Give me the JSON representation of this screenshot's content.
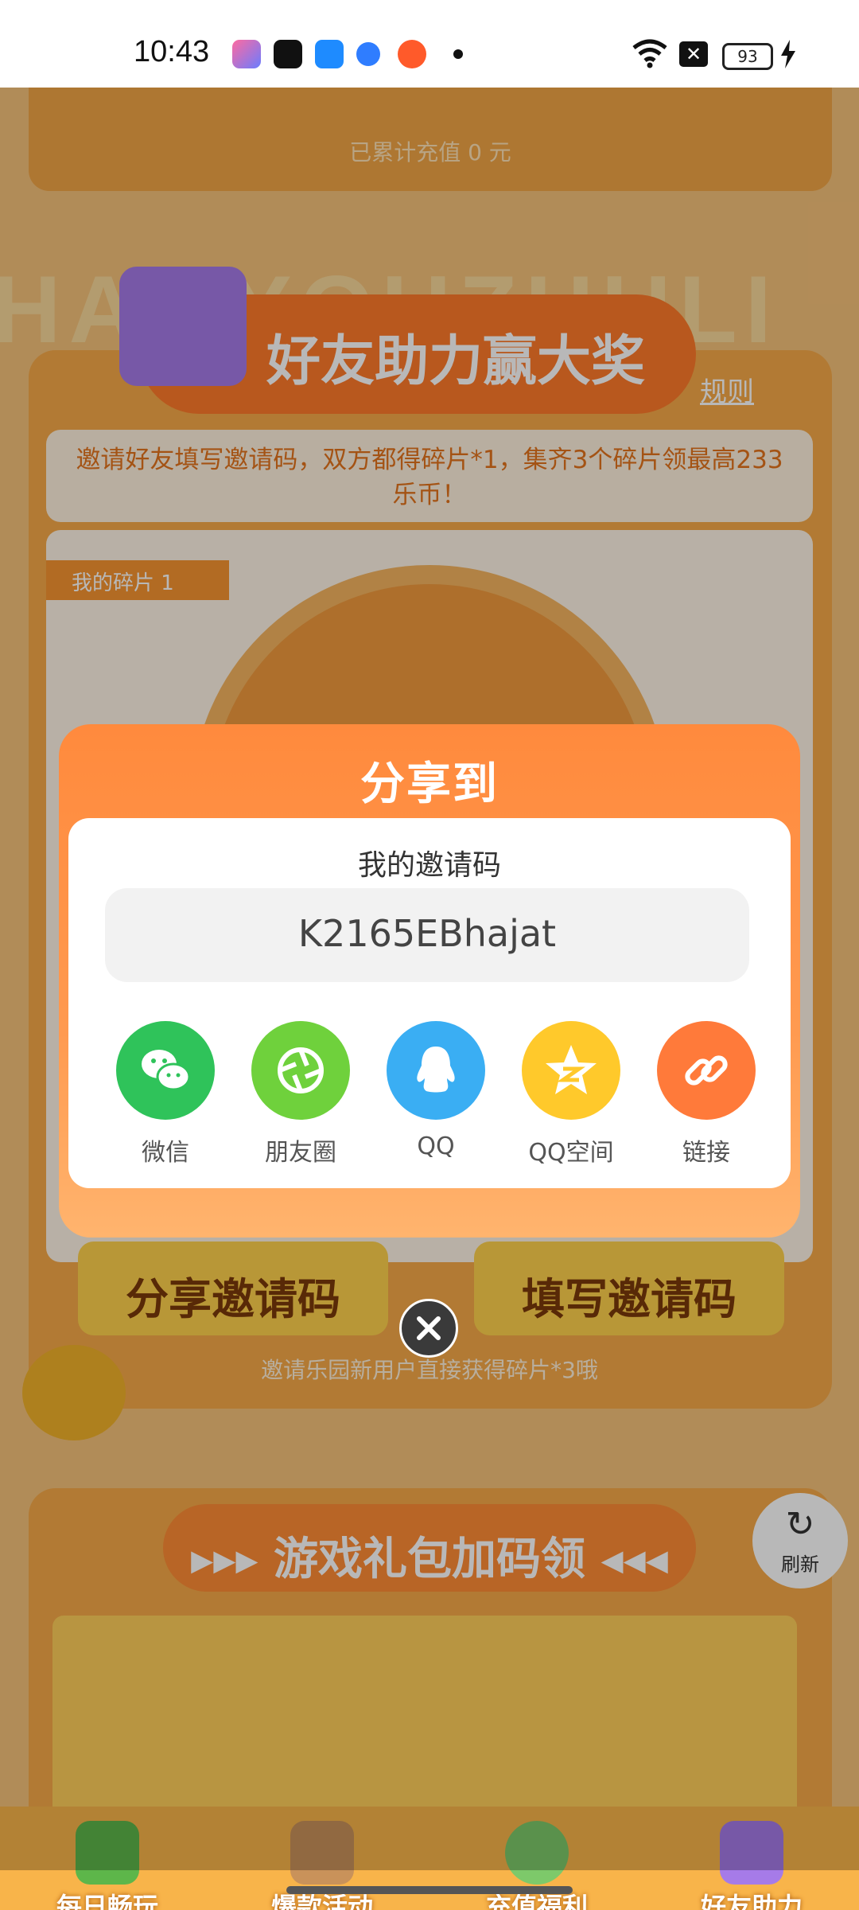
{
  "status_bar": {
    "time": "10:43",
    "battery": "93",
    "icons": [
      "app-icon-1",
      "app-icon-2",
      "app-icon-3",
      "app-icon-4",
      "app-icon-5",
      "dot-icon",
      "wifi-icon",
      "sim-x-icon",
      "battery-icon",
      "charging-icon"
    ]
  },
  "background": {
    "recharge_text": "已累计充值 0 元",
    "watermark": "HAOYOUZHULI",
    "friend_title": "好友助力赢大奖",
    "rules": "规则",
    "description": "邀请好友填写邀请码，双方都得碎片*1，集齐3个碎片领最高233乐币！",
    "pieces_tag": "我的碎片 1",
    "share_code_button": "分享邀请码",
    "fill_code_button": "填写邀请码",
    "invite_note": "邀请乐园新用户直接获得碎片*3哦",
    "game_title": "▸▸▸ 游戏礼包加码领 ◂◂◂",
    "refresh": "刷新"
  },
  "bottom_nav": [
    {
      "label": "每日畅玩\n享好礼"
    },
    {
      "label": "爆款活动\n派送中"
    },
    {
      "label": "充值福利\n大放送"
    },
    {
      "label": "好友助力\n赢大奖"
    }
  ],
  "dialog": {
    "title": "分享到",
    "code_label": "我的邀请码",
    "code_value": "K2165EBhajat",
    "share_targets": [
      {
        "label": "微信",
        "icon": "wechat-icon",
        "color": "#2fc35a"
      },
      {
        "label": "朋友圈",
        "icon": "moments-icon",
        "color": "#6fd13c"
      },
      {
        "label": "QQ",
        "icon": "qq-icon",
        "color": "#3aaef3"
      },
      {
        "label": "QQ空间",
        "icon": "qzone-icon",
        "color": "#ffc92b"
      },
      {
        "label": "链接",
        "icon": "link-icon",
        "color": "#ff7a3a"
      }
    ]
  },
  "colors": {
    "dialog_orange": "#ff8a3d",
    "page_orange": "#f7a948"
  }
}
